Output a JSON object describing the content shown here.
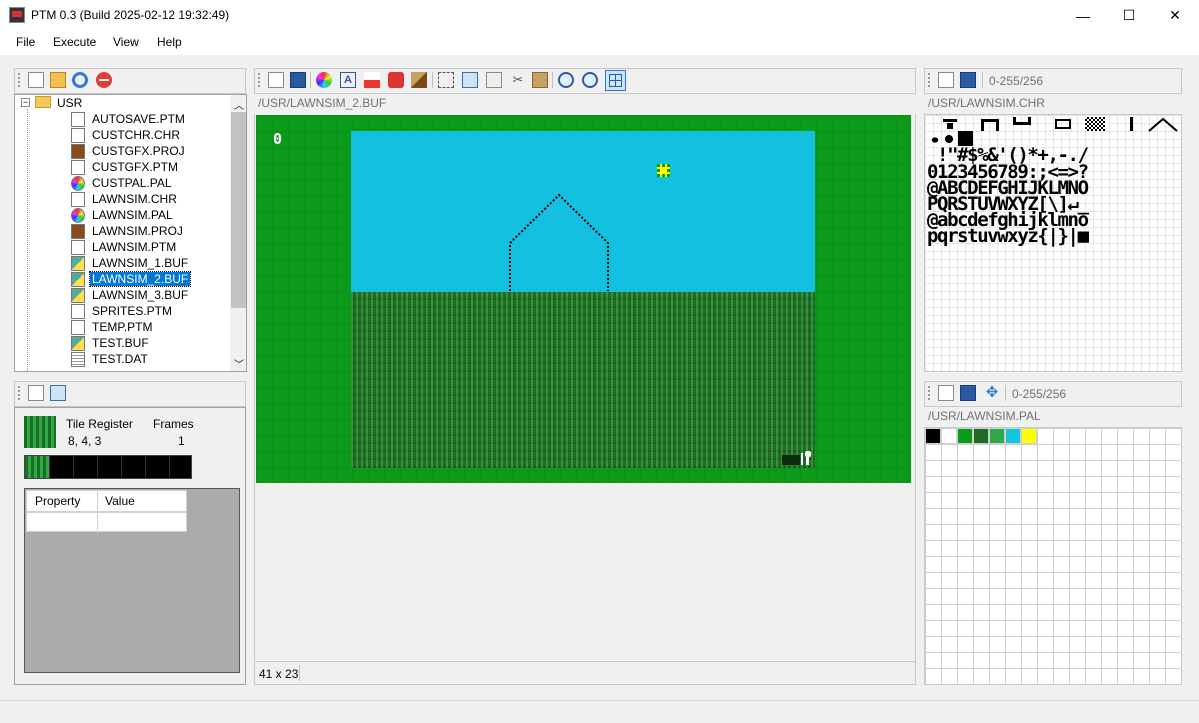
{
  "window": {
    "title": "PTM 0.3 (Build 2025-02-12 19:32:49)",
    "minimize": "—",
    "maximize": "☐",
    "close": "✕"
  },
  "menu": [
    "File",
    "Execute",
    "View",
    "Help"
  ],
  "tree": {
    "root": "USR",
    "items": [
      {
        "label": "AUTOSAVE.PTM",
        "icon": "document-icon"
      },
      {
        "label": "CUSTCHR.CHR",
        "icon": "font-icon"
      },
      {
        "label": "CUSTGFX.PROJ",
        "icon": "project-icon"
      },
      {
        "label": "CUSTGFX.PTM",
        "icon": "document-icon"
      },
      {
        "label": "CUSTPAL.PAL",
        "icon": "palette-icon"
      },
      {
        "label": "LAWNSIM.CHR",
        "icon": "font-icon"
      },
      {
        "label": "LAWNSIM.PAL",
        "icon": "palette-icon"
      },
      {
        "label": "LAWNSIM.PROJ",
        "icon": "project-icon"
      },
      {
        "label": "LAWNSIM.PTM",
        "icon": "document-icon"
      },
      {
        "label": "LAWNSIM_1.BUF",
        "icon": "buffer-icon"
      },
      {
        "label": "LAWNSIM_2.BUF",
        "icon": "buffer-icon"
      },
      {
        "label": "LAWNSIM_3.BUF",
        "icon": "buffer-icon"
      },
      {
        "label": "SPRITES.PTM",
        "icon": "document-icon"
      },
      {
        "label": "TEMP.PTM",
        "icon": "document-icon"
      },
      {
        "label": "TEST.BUF",
        "icon": "buffer-icon"
      },
      {
        "label": "TEST.DAT",
        "icon": "data-icon"
      }
    ],
    "selected": "LAWNSIM_2.BUF"
  },
  "tile": {
    "register_label": "Tile Register",
    "register_value": "8, 4, 3",
    "frames_label": "Frames",
    "frames_value": "1",
    "property_header": "Property",
    "value_header": "Value"
  },
  "editor": {
    "path": "/USR/LAWNSIM_2.BUF",
    "status": "41 x 23",
    "score": "0"
  },
  "chr": {
    "range": "0-255/256",
    "path": "/USR/LAWNSIM.CHR",
    "rows": [
      " !\"#$%&'()*+,-./",
      "0123456789:;<=>?",
      "@ABCDEFGHIJKLMNO",
      "PQRSTUVWXYZ[\\]↵_",
      "@abcdefghijklmno",
      "pqrstuvwxyz{|}|■"
    ]
  },
  "pal": {
    "range": "0-255/256",
    "path": "/USR/LAWNSIM.PAL",
    "colors": [
      "#000000",
      "#ffffff",
      "#0c9a1a",
      "#1f6b24",
      "#2ea84a",
      "#17c4e0",
      "#ffff00"
    ]
  },
  "colors": {
    "border_green": "#0c9a1a",
    "sky": "#14c0e0",
    "grass_dark": "#1c6e22",
    "selection": "#0078d7"
  }
}
